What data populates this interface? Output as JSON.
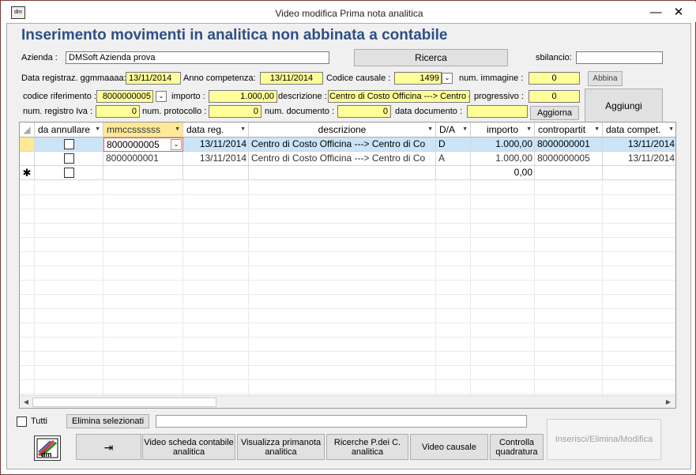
{
  "window": {
    "title": "Video modifica Prima nota analitica",
    "minimize": "—",
    "close": "✕",
    "icon_text": "dm"
  },
  "heading": "Inserimento movimenti in analitica non abbinata a contabile",
  "form": {
    "azienda_label": "Azienda :",
    "azienda_value": "DMSoft Azienda prova",
    "ricerca_label": "Ricerca",
    "sbilancio_label": "sbilancio:",
    "sbilancio_value": "",
    "data_reg_label": "Data registraz. ggmmaaaa:",
    "data_reg_value": "13/11/2014",
    "anno_comp_label": "Anno competenza:",
    "anno_comp_value": "13/11/2014",
    "codice_causale_label": "Codice causale :",
    "codice_causale_value": "1499",
    "num_immagine_label": "num. immagine :",
    "num_immagine_value": "0",
    "abbina_label": "Abbina",
    "codice_rif_label": "codice riferimento :",
    "codice_rif_value": "8000000005",
    "importo_label": "importo :",
    "importo_value": "1.000,00",
    "descrizione_label": "descrizione :",
    "descrizione_value": "Centro di Costo Officina ---> Centro di",
    "progressivo_label": "progressivo :",
    "progressivo_value": "0",
    "aggiungi_label": "Aggiungi",
    "num_reg_iva_label": "num. registro Iva :",
    "num_reg_iva_value": "0",
    "num_protocollo_label": "num. protocollo :",
    "num_protocollo_value": "0",
    "num_documento_label": "num. documento :",
    "num_documento_value": "0",
    "data_documento_label": "data documento :",
    "data_documento_value": "",
    "aggiorna_label": "Aggiorna"
  },
  "grid": {
    "columns": [
      "da annullare",
      "mmccssssss",
      "data reg.",
      "descrizione",
      "D/A",
      "importo",
      "contropartit",
      "data compet."
    ],
    "rows": [
      {
        "da_annullare": false,
        "conto": "8000000005",
        "data_reg": "13/11/2014",
        "descrizione": "Centro di Costo Officina ---> Centro di Co",
        "da": "D",
        "importo": "1.000,00",
        "contropartita": "8000000001",
        "data_compet": "13/11/2014"
      },
      {
        "da_annullare": false,
        "conto": "8000000001",
        "data_reg": "13/11/2014",
        "descrizione": "Centro di Costo Officina ---> Centro di Co",
        "da": "A",
        "importo": "1.000,00",
        "contropartita": "8000000005",
        "data_compet": "13/11/2014"
      }
    ],
    "new_row": {
      "marker": "✱",
      "importo": "0,00"
    }
  },
  "footer": {
    "tutti_label": "Tutti",
    "elimina_label": "Elimina selezionati",
    "status_value": "",
    "buttons": {
      "exit": "⇥",
      "video_scheda": "Video scheda contabile analitica",
      "visualizza": "Visualizza primanota analitica",
      "ricerche": "Ricerche P.dei C. analitica",
      "video_causale": "Video causale",
      "controlla": "Controlla quadratura",
      "inserisci": "Inserisci/Elimina/Modifica"
    }
  }
}
